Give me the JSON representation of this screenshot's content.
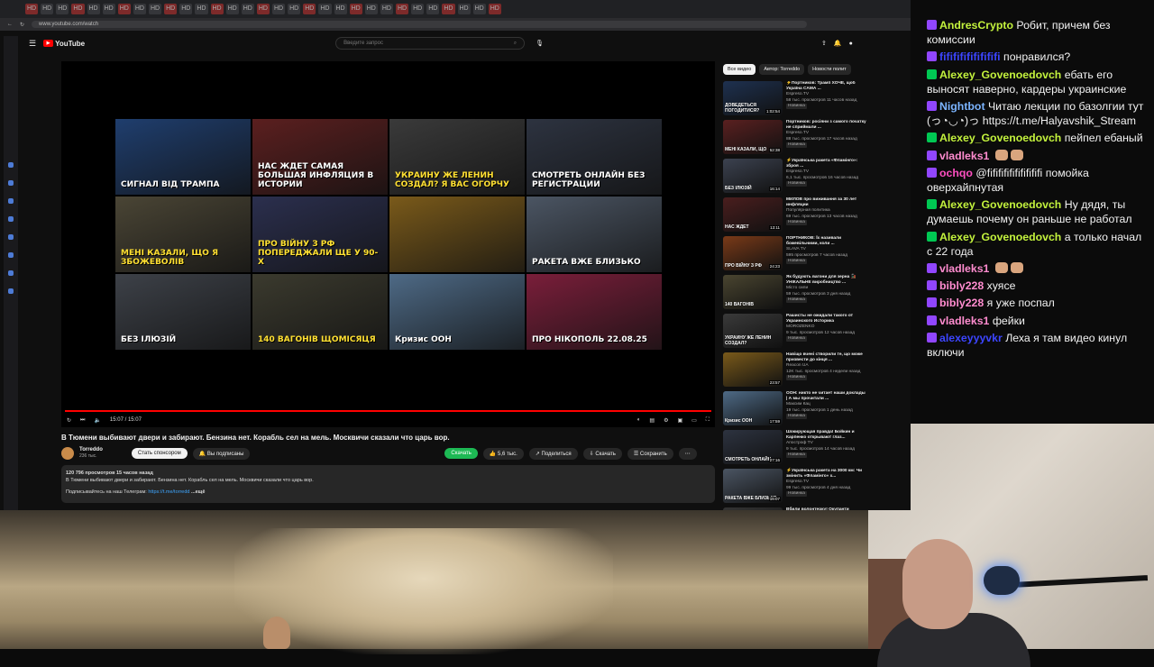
{
  "browser": {
    "tabs": [
      "HD",
      "HD",
      "HD",
      "HD",
      "HD",
      "HD",
      "HD",
      "HD",
      "HD",
      "HD",
      "HD",
      "HD",
      "HD",
      "HD",
      "HD",
      "HD",
      "HD",
      "HD",
      "HD",
      "HD",
      "HD",
      "HD",
      "HD",
      "HD",
      "HD",
      "HD",
      "HD",
      "HD",
      "HD",
      "HD",
      "HD"
    ],
    "url": "www.youtube.com/watch"
  },
  "youtube": {
    "logo": "YouTube",
    "search_placeholder": "Введите запрос",
    "player": {
      "time": "15:07 / 15:07",
      "thumbnails": [
        {
          "caption": "СИГНАЛ ВІД ТРАМПА",
          "bg": "#1f3e6e",
          "style": ""
        },
        {
          "caption": "НАС ЖДЕТ САМАЯ БОЛЬШАЯ ИНФЛЯЦИЯ В ИСТОРИИ",
          "bg": "#5b1f1f",
          "style": ""
        },
        {
          "caption": "УКРАИНУ ЖЕ ЛЕНИН СОЗДАЛ? Я ВАС ОГОРЧУ",
          "bg": "#3a3a3a",
          "style": "y"
        },
        {
          "caption": "СМОТРЕТЬ ОНЛАЙН БЕЗ РЕГИСТРАЦИИ",
          "bg": "#2d3340",
          "style": ""
        },
        {
          "caption": "МЕНІ КАЗАЛИ, ЩО Я ЗБОЖЕВОЛІВ",
          "bg": "#4a4535",
          "style": "y"
        },
        {
          "caption": "ПРО ВІЙНУ З РФ ПОПЕРЕДЖАЛИ ЩЕ У 90-Х",
          "bg": "#2b2f4e",
          "style": "y"
        },
        {
          "caption": "",
          "bg": "#7a5a1a",
          "style": ""
        },
        {
          "caption": "РАКЕТА ВЖЕ БЛИЗЬКО",
          "bg": "#4b5563",
          "style": ""
        },
        {
          "caption": "БЕЗ ІЛЮЗІЙ",
          "bg": "#3d4148",
          "style": ""
        },
        {
          "caption": "140 ВАГОНІВ ЩОМІСЯЦЯ",
          "bg": "#3b3a2e",
          "style": "y"
        },
        {
          "caption": "Кризис ООН",
          "bg": "#4e6a86",
          "style": ""
        },
        {
          "caption": "ПРО НІКОПОЛЬ 22.08.25",
          "bg": "#7a1e3a",
          "style": ""
        }
      ]
    },
    "video": {
      "title": "В Тюмени выбивают двери и забирают. Бензина нет. Корабль сел на мель. Москвичи сказали что царь вор.",
      "channel": "Torreddo",
      "subs": "236 тыс.",
      "sponsor": "Стать спонсором",
      "subscribed": "Вы подписаны",
      "download": "Скачать",
      "likes": "5,6 тыс.",
      "share": "Поделиться",
      "download2": "Скачать",
      "save": "Сохранить",
      "views": "120 796 просмотров  15 часов назад",
      "desc": "В Тюмени выбивают двери и забирают. Бензина нет. Корабль сел на мель. Москвичи сказали что царь вор.",
      "tg_label": "Подписывайтесь на наш Телеграм:",
      "tg_link": "https://t.me/torredd",
      "more": "...ещё"
    },
    "chips": [
      "Все видео",
      "Автор: Torreddo",
      "Новости полит"
    ],
    "recs": [
      {
        "title": "⚡Портников: Трамп ХОЧЕ, щоб Україна САМА ...",
        "channel": "Espreso.TV",
        "views": "58 тыс. просмотров  11 часов назад",
        "dur": "1:02:54",
        "bg": "#1e3150",
        "cap": "ДОВЕДЕТЬСЯ ПОГОДИТИСЯ?"
      },
      {
        "title": "Портников: росіяни з самого початку не сприймали ...",
        "channel": "Espreso.TV",
        "views": "88 тыс. просмотров  17 часов назад",
        "dur": "52:38",
        "bg": "#5a2020",
        "cap": "МЕНІ КАЗАЛИ, ЩО"
      },
      {
        "title": "⚡Українська ракета «Фламінго»: зброя ...",
        "channel": "Espreso.TV",
        "views": "6,1 тыс. просмотров  16 часов назад",
        "dur": "16:14",
        "bg": "#3c4250",
        "cap": "БЕЗ ІЛЮЗІЙ"
      },
      {
        "title": "МИЛОВ про виживання за 30 лет инфляции",
        "channel": "Популярная политика",
        "views": "69 тыс. просмотров  13 часов назад",
        "dur": "13:11",
        "bg": "#4a1e1e",
        "cap": "НАС ЖДЕТ"
      },
      {
        "title": "ПОРТНИКОВ: Їх називали божевільними, коли ...",
        "channel": "SLAVA TV",
        "views": "595 просмотров  7 часов назад",
        "dur": "24:23",
        "bg": "#7a3a18",
        "cap": "ПРО ВІЙНУ З РФ"
      },
      {
        "title": "Як будують вагони для зерна 🚂 УНІКАЛЬНЕ виробництво ...",
        "channel": "Місто сили",
        "views": "59 тыс. просмотров  3 дня назад",
        "dur": "",
        "bg": "#4a4530",
        "cap": "140 ВАГОНІВ"
      },
      {
        "title": "Рашисты не ожидали такого от Украинского Историка",
        "channel": "MOROZENKO",
        "views": "9 тыс. просмотров  12 часов назад",
        "dur": "",
        "bg": "#3a3a3a",
        "cap": "УКРАИНУ ЖЕ ЛЕНИН СОЗДАЛ?"
      },
      {
        "title": "Навіщо вчені створили те, що може призвести до кінця ...",
        "channel": "Reacon UA",
        "views": "12K тыс. просмотров  4 недели назад",
        "dur": "23:57",
        "bg": "#7a5a1a",
        "cap": ""
      },
      {
        "title": "ООН: никто не читает наши доклады | А мы прочитали ...",
        "channel": "Максим Кац",
        "views": "19 тыс. просмотров  1 день назад",
        "dur": "17:59",
        "bg": "#4e6a86",
        "cap": "Кризис ООН"
      },
      {
        "title": "Шокирующая правда! Бойкин и Карпенко открывают глаз...",
        "channel": "Апостроф TV",
        "views": "9 тыс. просмотров  14 часов назад",
        "dur": "27:16",
        "bg": "#2d3340",
        "cap": "СМОТРЕТЬ ОНЛАЙН"
      },
      {
        "title": "⚡Українська ракета на 3000 км: Чи змінить «Фламінго» х...",
        "channel": "Espreso.TV",
        "views": "99 тыс. просмотров  4 дня назад",
        "dur": "16:07",
        "bg": "#4b5563",
        "cap": "РАКЕТА ВЖЕ БЛИЗЬКО"
      },
      {
        "title": "Вбили волонтерку! Окупанти",
        "channel": "",
        "views": "",
        "dur": "",
        "bg": "#333",
        "cap": ""
      }
    ]
  },
  "chat": [
    {
      "user": "AndresCrypto",
      "color": "#c3f23d",
      "icon": "#9146ff",
      "text": "Робит, причем без комиссии"
    },
    {
      "user": "fififififififififi",
      "color": "#3c45ff",
      "icon": "#9146ff",
      "text": "понравился?"
    },
    {
      "user": "Alexey_Govenoedovch",
      "color": "#c3f23d",
      "icon": "#00c853",
      "text": "ебать его выносят наверно, кардеры украинские"
    },
    {
      "user": "Nightbot",
      "color": "#7bb4ff",
      "icon": "#9146ff",
      "text": "Читаю лекции по базолгии тут (っ◔◡◔)っ https://t.me/Halyavshik_Stream"
    },
    {
      "user": "Alexey_Govenoedovch",
      "color": "#c3f23d",
      "icon": "#00c853",
      "text": "пейпел ебаный"
    },
    {
      "user": "vladleks1",
      "color": "#ff8ccf",
      "icon": "#9146ff",
      "text": ""
    },
    {
      "user": "ochqo",
      "color": "#ff4fc1",
      "icon": "#9146ff",
      "text": "@fifififififififififi помойка оверхайпнутая"
    },
    {
      "user": "Alexey_Govenoedovch",
      "color": "#c3f23d",
      "icon": "#00c853",
      "text": "Ну дядя, ты думаешь почему он раньше не работал"
    },
    {
      "user": "Alexey_Govenoedovch",
      "color": "#c3f23d",
      "icon": "#00c853",
      "text": "а только начал с 22 года"
    },
    {
      "user": "vladleks1",
      "color": "#ff8ccf",
      "icon": "#9146ff",
      "text": ""
    },
    {
      "user": "bibly228",
      "color": "#ff8ccf",
      "icon": "#9146ff",
      "text": "хуясе"
    },
    {
      "user": "bibly228",
      "color": "#ff8ccf",
      "icon": "#9146ff",
      "text": "я уже поспал"
    },
    {
      "user": "vladleks1",
      "color": "#ff8ccf",
      "icon": "#9146ff",
      "text": "фейки"
    },
    {
      "user": "alexeyyyvkr",
      "color": "#3c45ff",
      "icon": "#9146ff",
      "text": "Леха я там видео кинул включи"
    }
  ]
}
